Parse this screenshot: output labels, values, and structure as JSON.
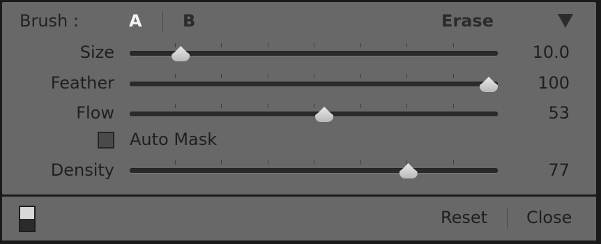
{
  "brush": {
    "label": "Brush :",
    "option_a": "A",
    "option_b": "B",
    "erase": "Erase"
  },
  "sliders": [
    {
      "name": "Size",
      "value": "10.0",
      "level": 0.12
    },
    {
      "name": "Feather",
      "value": "100",
      "level": 1.0
    },
    {
      "name": "Flow",
      "value": "53",
      "level": 0.53
    },
    {
      "name": "Density",
      "value": "77",
      "level": 0.77
    }
  ],
  "auto_mask": {
    "label": "Auto Mask",
    "checked": false
  },
  "footer": {
    "reset": "Reset",
    "close": "Close"
  },
  "icons": {
    "menu": "triangle-down-icon",
    "toggle": "panel-switch-icon"
  }
}
